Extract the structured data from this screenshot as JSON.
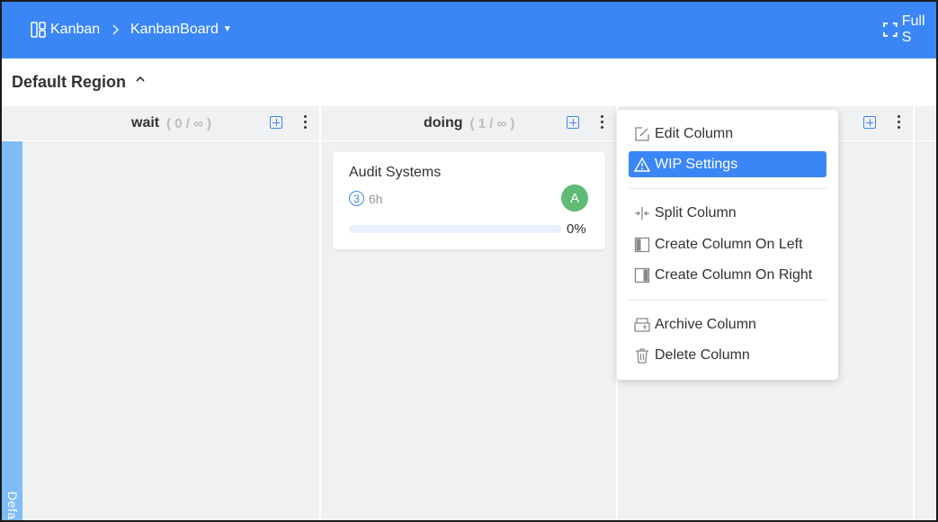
{
  "header": {
    "breadcrumb_root": "Kanban",
    "breadcrumb_separator": ">",
    "breadcrumb_board": "KanbanBoard",
    "fullscreen_label": "Full S",
    "bg_color": "#3b86f7"
  },
  "region": {
    "title": "Default Region",
    "lane_label": "Defa"
  },
  "columns": [
    {
      "title": "wait",
      "limit": "( 0 / ∞ )"
    },
    {
      "title": "doing",
      "limit": "( 1 / ∞ )"
    }
  ],
  "card": {
    "title": "Audit Systems",
    "priority": "3",
    "estimate": "6h",
    "avatar": "A",
    "progress": 0,
    "progress_label": "0%"
  },
  "menu": {
    "items": [
      {
        "label": "Edit Column",
        "icon": "edit-icon"
      },
      {
        "label": "WIP Settings",
        "icon": "warning-icon",
        "active": true
      },
      {
        "label": "Split Column",
        "icon": "split-icon"
      },
      {
        "label": "Create Column On Left",
        "icon": "column-left-icon"
      },
      {
        "label": "Create Column On Right",
        "icon": "column-right-icon"
      },
      {
        "label": "Archive Column",
        "icon": "archive-icon"
      },
      {
        "label": "Delete Column",
        "icon": "trash-icon"
      }
    ]
  }
}
